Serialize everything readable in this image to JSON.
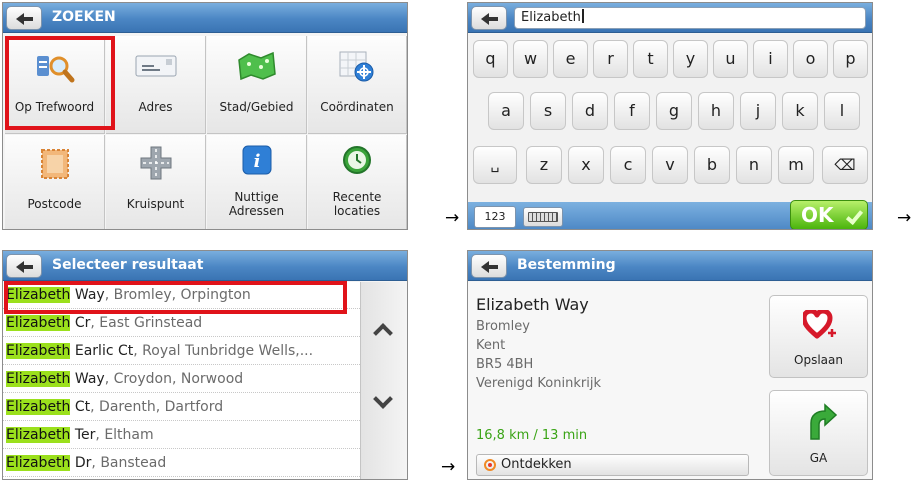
{
  "arrows": [
    "→",
    "→",
    "→"
  ],
  "zoeken": {
    "title": "ZOEKEN",
    "tiles": [
      {
        "label": "Op Trefwoord",
        "icon": "keyword-search-icon"
      },
      {
        "label": "Adres",
        "icon": "address-card-icon"
      },
      {
        "label": "Stad/Gebied",
        "icon": "city-map-icon"
      },
      {
        "label": "Coördinaten",
        "icon": "coordinates-icon"
      },
      {
        "label": "Postcode",
        "icon": "postcode-stamp-icon"
      },
      {
        "label": "Kruispunt",
        "icon": "crossroads-icon"
      },
      {
        "label_line1": "Nuttige",
        "label_line2": "Adressen",
        "icon": "info-icon"
      },
      {
        "label_line1": "Recente",
        "label_line2": "locaties",
        "icon": "clock-icon"
      }
    ],
    "highlight_color": "#e0131a"
  },
  "keyboard": {
    "input_value": "Elizabeth",
    "row1": [
      "q",
      "w",
      "e",
      "r",
      "t",
      "y",
      "u",
      "i",
      "o",
      "p"
    ],
    "row2": [
      "a",
      "s",
      "d",
      "f",
      "g",
      "h",
      "j",
      "k",
      "l"
    ],
    "row3": [
      "␣",
      "z",
      "x",
      "c",
      "v",
      "b",
      "n",
      "m",
      "⌫"
    ],
    "numbers_label": "123",
    "ok_label": "OK"
  },
  "results": {
    "title": "Selecteer resultaat",
    "match": "Elizabeth",
    "highlight_color": "#9be01c",
    "rows": [
      {
        "street": "Way",
        "rest": ", Bromley, Orpington"
      },
      {
        "street": "Cr",
        "rest": ", East Grinstead"
      },
      {
        "street": "Earlic Ct",
        "rest": ", Royal Tunbridge Wells,..."
      },
      {
        "street": "Way",
        "rest": ", Croydon, Norwood"
      },
      {
        "street": "Ct",
        "rest": ", Darenth, Dartford"
      },
      {
        "street": "Ter",
        "rest": ", Eltham"
      },
      {
        "street": "Dr",
        "rest": ", Banstead"
      }
    ]
  },
  "destination": {
    "title": "Bestemming",
    "name": "Elizabeth Way",
    "lines": [
      "Bromley",
      "Kent",
      "BR5 4BH",
      "Verenigd Koninkrijk"
    ],
    "distance": "16,8 km / 13 min",
    "explore_label": "Ontdekken",
    "save_label": "Opslaan",
    "go_label": "GA"
  }
}
